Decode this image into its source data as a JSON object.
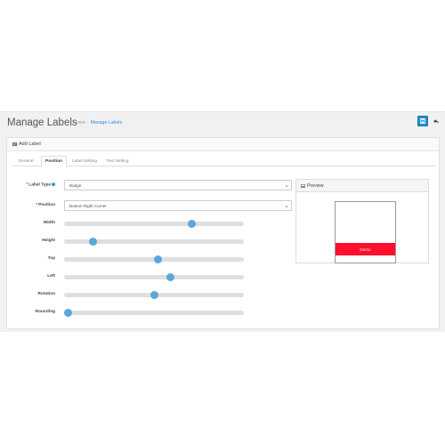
{
  "header": {
    "title": "Manage Labels",
    "breadcrumb": [
      {
        "label": "Home"
      },
      {
        "label": "Manage Labels"
      }
    ],
    "breadcrumb_separator": "›",
    "save_icon": "floppy-disk-icon",
    "back_icon": "reply-arrow-icon",
    "save_color": "#1e91cf"
  },
  "panel": {
    "heading": "Add Label",
    "heading_icon": "pencil-icon"
  },
  "tabs": [
    {
      "label": "General",
      "active": false
    },
    {
      "label": "Position",
      "active": true
    },
    {
      "label": "Label Setting",
      "active": false
    },
    {
      "label": "Text Setting",
      "active": false
    }
  ],
  "form": {
    "label_type": {
      "label": "Label Type",
      "required": true,
      "value": "Badge"
    },
    "position": {
      "label": "Position",
      "required": true,
      "value": "Bottom Right Corner"
    },
    "sliders": [
      {
        "label": "Width",
        "fraction": 0.71
      },
      {
        "label": "Height",
        "fraction": 0.16
      },
      {
        "label": "Top",
        "fraction": 0.52
      },
      {
        "label": "Left",
        "fraction": 0.59
      },
      {
        "label": "Rotation",
        "fraction": 0.5
      },
      {
        "label": "Rounding",
        "fraction": 0.02
      }
    ]
  },
  "preview": {
    "heading": "Preview",
    "heading_icon": "image-icon",
    "label_text": "Demo",
    "label_color": "#ff0f2b"
  },
  "colors": {
    "accent": "#1e91cf",
    "slider_thumb": "#5aa7dd",
    "required": "#e3203a"
  }
}
